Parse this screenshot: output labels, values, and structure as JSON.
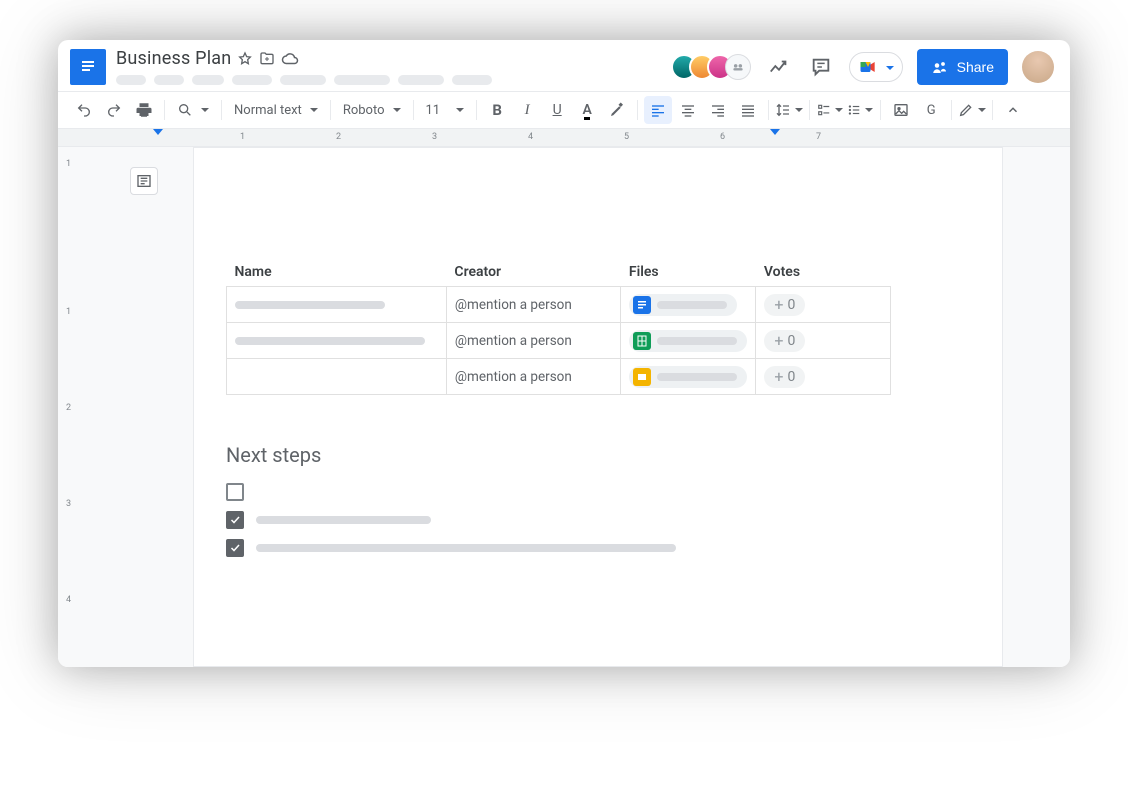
{
  "header": {
    "doc_title": "Business Plan",
    "share_label": "Share"
  },
  "toolbar": {
    "style_select": "Normal text",
    "font_select": "Roboto",
    "font_size": "11"
  },
  "ruler": {
    "ticks": [
      "1",
      "2",
      "3",
      "4",
      "5",
      "6",
      "7"
    ]
  },
  "vruler": {
    "ticks": [
      "1",
      "1",
      "2",
      "3",
      "4"
    ]
  },
  "table": {
    "headers": {
      "name": "Name",
      "creator": "Creator",
      "files": "Files",
      "votes": "Votes"
    },
    "mention_placeholder": "@mention a person",
    "vote_value": "0",
    "rows": [
      {
        "file_type": "doc"
      },
      {
        "file_type": "sheet"
      },
      {
        "file_type": "slide"
      }
    ]
  },
  "next_steps": {
    "heading": "Next steps",
    "items": [
      {
        "checked": false
      },
      {
        "checked": true
      },
      {
        "checked": true
      }
    ]
  }
}
